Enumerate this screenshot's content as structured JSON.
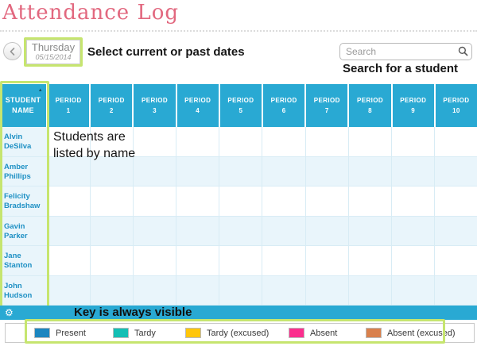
{
  "page_title": "Attendance Log",
  "colors": {
    "accent_cyan": "#29a9d3",
    "row_tint": "#e9f5fb",
    "title_pink": "#e2687f",
    "annotation_green": "#c6e56f"
  },
  "toolbar": {
    "back_icon": "‹",
    "date_day": "Thursday",
    "date_value": "05/15/2014",
    "search_placeholder": "Search"
  },
  "annotations": {
    "date_note": "Select current or past dates",
    "search_note": "Search for a student",
    "students_note": "Students are\nlisted by name",
    "key_note": "Key is always visible"
  },
  "table": {
    "student_header": "STUDENT\nNAME",
    "sort_icon": "▲",
    "period_label": "PERIOD",
    "period_numbers": [
      "1",
      "2",
      "3",
      "4",
      "5",
      "6",
      "7",
      "8",
      "9",
      "10"
    ],
    "students": [
      {
        "first": "Alvin",
        "last": "DeSilva"
      },
      {
        "first": "Amber",
        "last": "Phillips"
      },
      {
        "first": "Felicity",
        "last": "Bradshaw"
      },
      {
        "first": "Gavin",
        "last": "Parker"
      },
      {
        "first": "Jane",
        "last": "Stanton"
      },
      {
        "first": "John",
        "last": "Hudson"
      }
    ]
  },
  "footer": {
    "gear_icon": "⚙",
    "legend": [
      {
        "label": "Present",
        "color": "#1c86c0"
      },
      {
        "label": "Tardy",
        "color": "#14bfb4"
      },
      {
        "label": "Tardy (excused)",
        "color": "#ffc60a"
      },
      {
        "label": "Absent",
        "color": "#fb2e8e"
      },
      {
        "label": "Absent (excused)",
        "color": "#d9804c"
      }
    ]
  }
}
